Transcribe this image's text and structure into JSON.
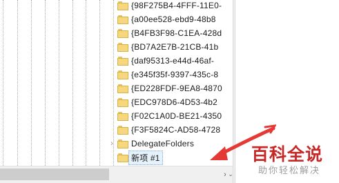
{
  "tree": {
    "rows": [
      {
        "label": "{98F275B4-4FFF-11E0-",
        "expander": ""
      },
      {
        "label": "{a00ee528-ebd9-48b8",
        "expander": ""
      },
      {
        "label": "{B4FB3F98-C1EA-428d",
        "expander": ""
      },
      {
        "label": "{BD7A2E7B-21CB-41b",
        "expander": ""
      },
      {
        "label": "{daf95313-e44d-46af-",
        "expander": ""
      },
      {
        "label": "{e345f35f-9397-435c-8",
        "expander": ""
      },
      {
        "label": "{ED228FDF-9EA8-4870",
        "expander": ""
      },
      {
        "label": "{EDC978D6-4D53-4b2",
        "expander": ""
      },
      {
        "label": "{F02C1A0D-BE21-4350",
        "expander": ""
      },
      {
        "label": "{F3F5824C-AD58-4728",
        "expander": ""
      },
      {
        "label": "DelegateFolders",
        "expander": "›"
      },
      {
        "label": "新项 #1",
        "expander": ""
      }
    ],
    "selected_label": "新项 #1"
  },
  "scrollbar": {
    "right_arrow": "›",
    "down_arrow": "⌄"
  },
  "watermark": {
    "title": "百科全说",
    "subtitle": "助你轻松解决",
    "color": "#c62828"
  },
  "annotation": {
    "arrow_color": "#e53935"
  }
}
